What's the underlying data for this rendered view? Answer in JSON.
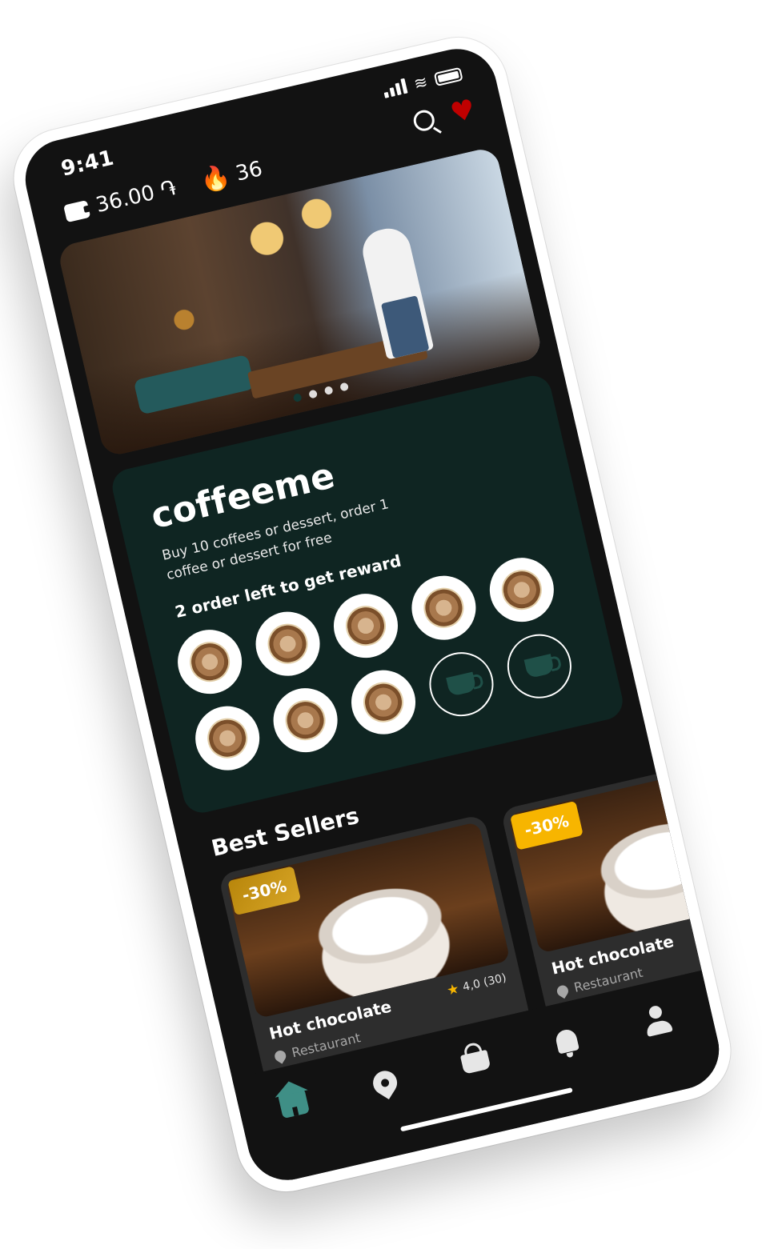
{
  "status_bar": {
    "time": "9:41"
  },
  "header": {
    "balance": "36.00 ֏",
    "streak_count": "36",
    "icons": [
      "wallet-icon",
      "flame-icon",
      "search-icon",
      "heart-icon"
    ],
    "colors": {
      "flame": "#e2a21b",
      "heart": "#c00000"
    }
  },
  "hero": {
    "slide_count": 4,
    "active_slide": 1
  },
  "loyalty": {
    "brand": "coffeeme",
    "description": "Buy 10 coffees or dessert, order 1 coffee or dessert for free",
    "progress_label": "2 order left to get reward",
    "stamps_total": 10,
    "stamps_collected": 8,
    "colors": {
      "card": "#0f2522",
      "empty_cup": "#1f5048"
    }
  },
  "best_sellers": {
    "title": "Best Sellers",
    "products": [
      {
        "name": "Hot chocolate",
        "location": "Restaurant",
        "discount": "-30%",
        "rating": "4,0 (30)"
      },
      {
        "name": "Hot chocolate",
        "location": "Restaurant",
        "discount": "-30%"
      }
    ],
    "colors": {
      "badge_gold": "#c9961c",
      "badge_amber": "#f7b500"
    }
  },
  "bottom_nav": {
    "items": [
      "home-icon",
      "map-pin-icon",
      "basket-icon",
      "bell-icon",
      "profile-icon"
    ],
    "active": "home-icon",
    "colors": {
      "active": "#3f8f86",
      "inactive": "#e6e6e6"
    }
  }
}
